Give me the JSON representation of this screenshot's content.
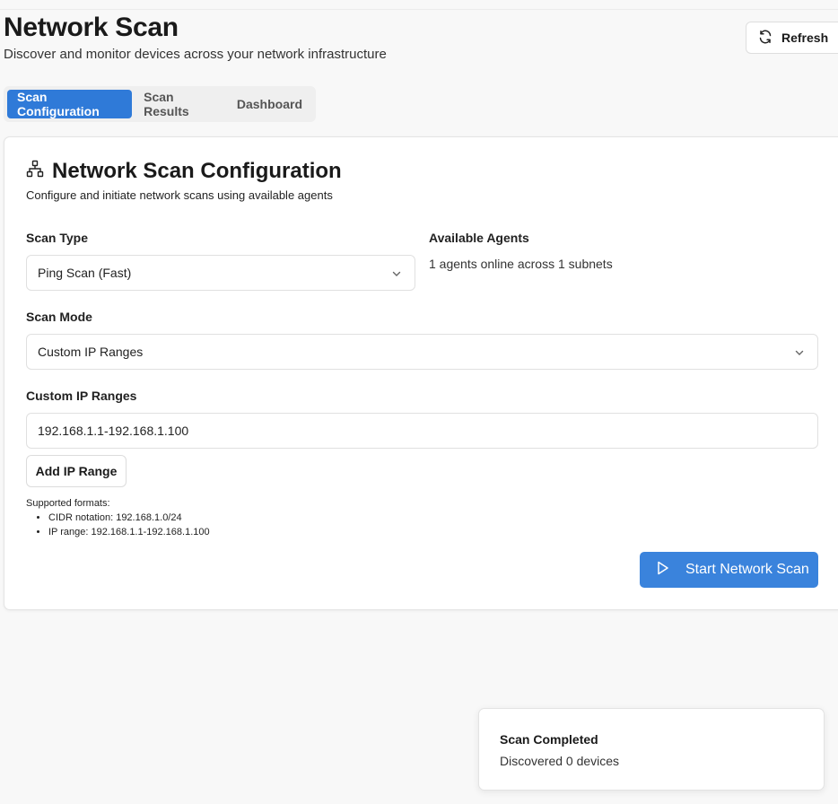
{
  "header": {
    "title": "Network Scan",
    "subtitle": "Discover and monitor devices across your network infrastructure",
    "refresh_label": "Refresh"
  },
  "tabs": [
    {
      "label": "Scan Configuration",
      "active": true
    },
    {
      "label": "Scan Results",
      "active": false
    },
    {
      "label": "Dashboard",
      "active": false
    }
  ],
  "config": {
    "title": "Network Scan Configuration",
    "description": "Configure and initiate network scans using available agents",
    "scan_type_label": "Scan Type",
    "scan_type_value": "Ping Scan (Fast)",
    "agents_label": "Available Agents",
    "agents_text": "1 agents online across 1 subnets",
    "scan_mode_label": "Scan Mode",
    "scan_mode_value": "Custom IP Ranges",
    "ip_ranges_label": "Custom IP Ranges",
    "ip_range_value": "192.168.1.1-192.168.1.100",
    "add_range_label": "Add IP Range",
    "formats_title": "Supported formats:",
    "formats": [
      "CIDR notation: 192.168.1.0/24",
      "IP range: 192.168.1.1-192.168.1.100"
    ],
    "start_label": "Start Network Scan"
  },
  "toast": {
    "title": "Scan Completed",
    "message": "Discovered 0 devices"
  },
  "icons": {
    "refresh": "refresh-icon",
    "network": "network-icon",
    "chevron": "chevron-down-icon",
    "play": "play-icon"
  },
  "colors": {
    "accent": "#2f7ad8",
    "start_button": "#3a83dc"
  }
}
